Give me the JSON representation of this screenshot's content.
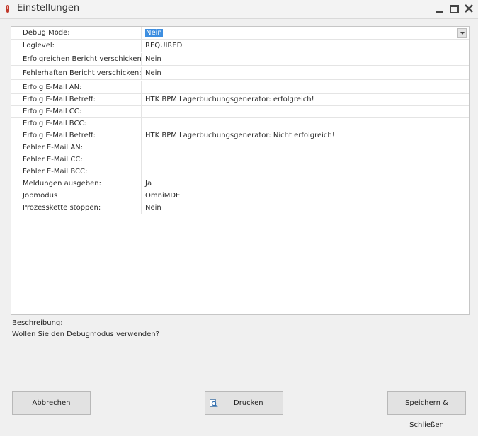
{
  "window": {
    "title": "Einstellungen"
  },
  "properties": [
    {
      "name": "Debug Mode:",
      "value": "Nein"
    },
    {
      "name": "Loglevel:",
      "value": "REQUIRED"
    },
    {
      "name": "Erfolgreichen Bericht verschicken:",
      "value": "Nein"
    },
    {
      "name": "Fehlerhaften Bericht verschicken:",
      "value": "Nein"
    },
    {
      "name": "Erfolg E-Mail AN:",
      "value": ""
    },
    {
      "name": "Erfolg E-Mail Betreff:",
      "value": "HTK BPM Lagerbuchungsgenerator: erfolgreich!"
    },
    {
      "name": "Erfolg E-Mail CC:",
      "value": ""
    },
    {
      "name": "Erfolg E-Mail BCC:",
      "value": ""
    },
    {
      "name": "Erfolg E-Mail Betreff:",
      "value": "HTK BPM Lagerbuchungsgenerator: Nicht erfolgreich!"
    },
    {
      "name": "Fehler E-Mail AN:",
      "value": ""
    },
    {
      "name": "Fehler E-Mail CC:",
      "value": ""
    },
    {
      "name": "Fehler E-Mail BCC:",
      "value": ""
    },
    {
      "name": "Meldungen ausgeben:",
      "value": "Ja"
    },
    {
      "name": "Jobmodus",
      "value": "OmniMDE"
    },
    {
      "name": "Prozesskette stoppen:",
      "value": "Nein"
    }
  ],
  "description": {
    "label": "Beschreibung:",
    "text": "Wollen Sie den Debugmodus verwenden?"
  },
  "buttons": {
    "cancel": "Abbrechen",
    "print": "Drucken",
    "save": "Speichern & Schließen"
  },
  "icons": {
    "app": "app-icon",
    "minimize": "minimize-icon",
    "maximize": "maximize-icon",
    "close": "close-icon",
    "dropdown": "chevron-down-icon",
    "print": "print-preview-icon"
  },
  "colors": {
    "selection": "#3d8ee0",
    "app_icon": "#c0392b"
  }
}
